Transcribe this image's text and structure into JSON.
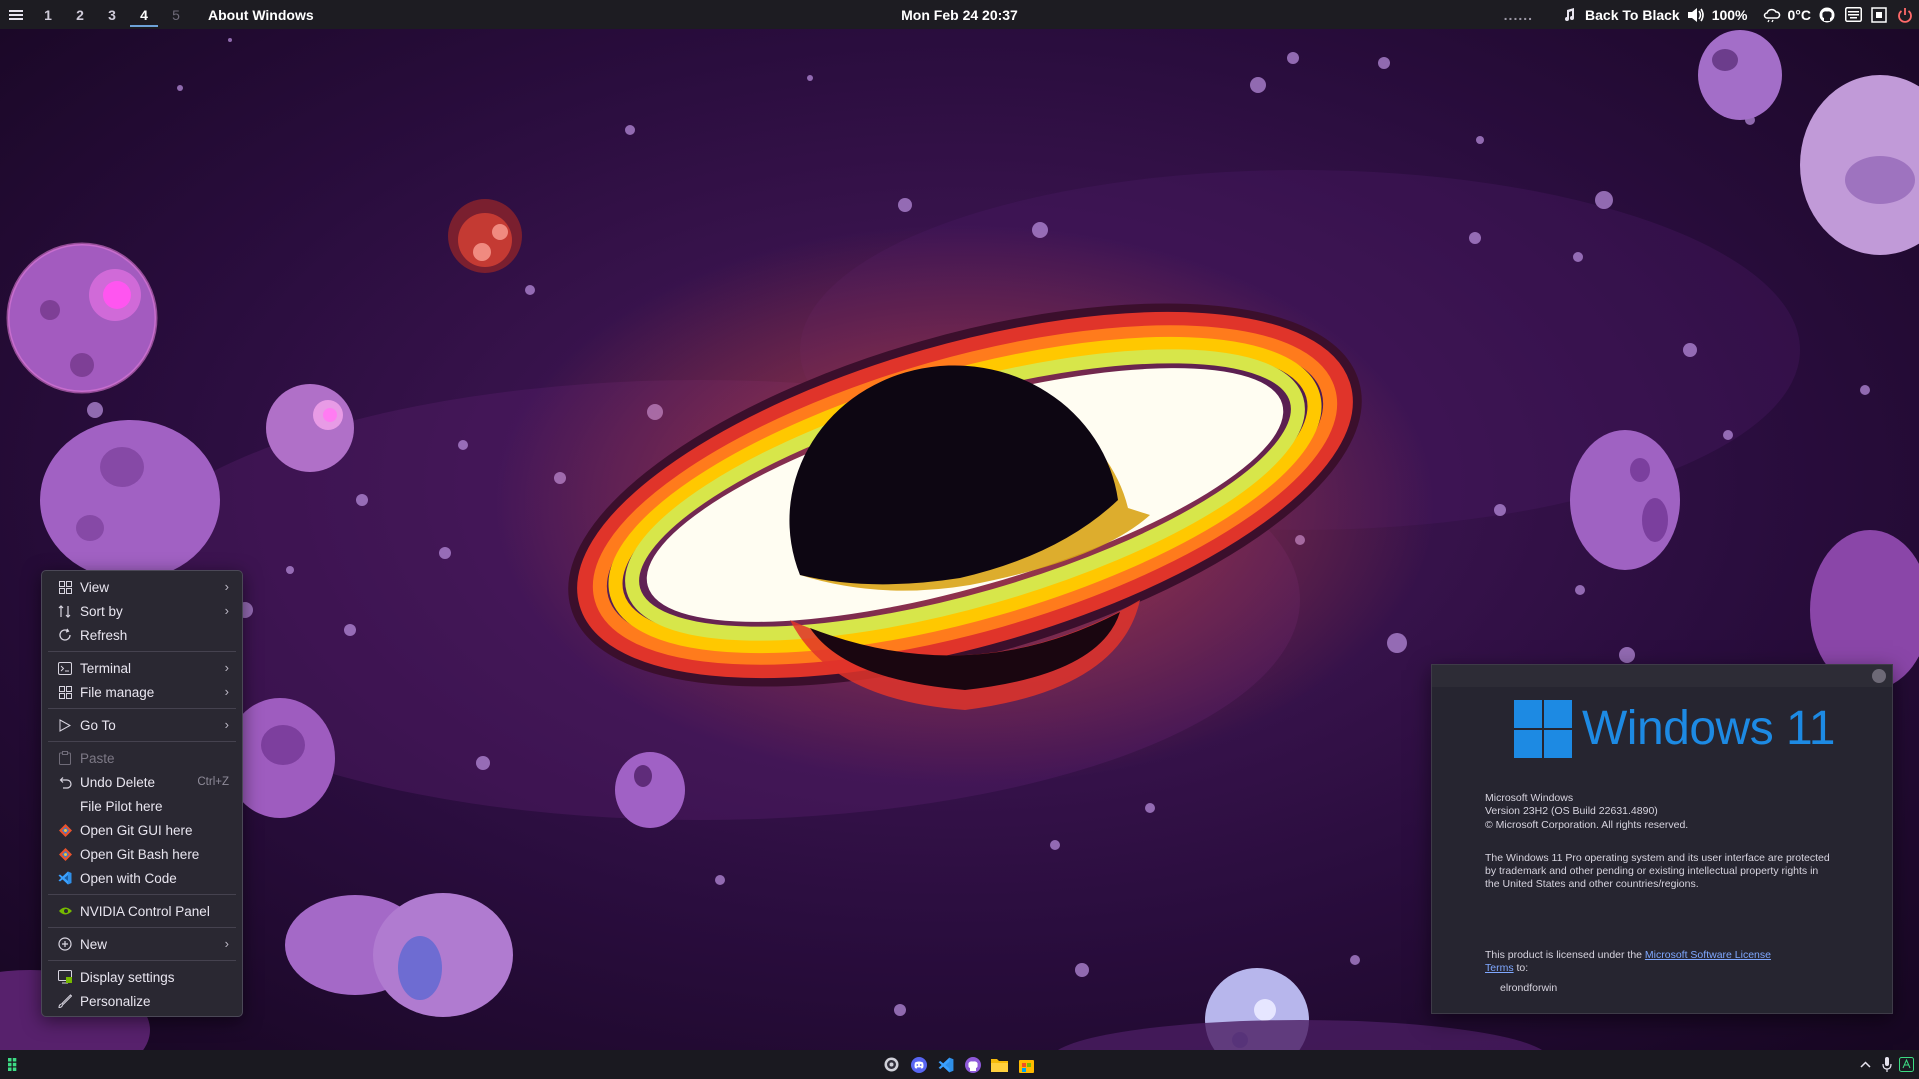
{
  "topbar": {
    "workspaces": [
      "1",
      "2",
      "3",
      "4",
      "5"
    ],
    "active_workspace": "4",
    "window_title": "About Windows",
    "clock": "Mon Feb 24 20:37",
    "dots": "......",
    "media": "Back To Black",
    "volume": "100%",
    "weather": "0°C"
  },
  "context_menu": {
    "view": "View",
    "sort_by": "Sort by",
    "refresh": "Refresh",
    "terminal": "Terminal",
    "file_manage": "File manage",
    "go_to": "Go To",
    "paste": "Paste",
    "undo_delete": "Undo Delete",
    "undo_shortcut": "Ctrl+Z",
    "file_pilot": "File Pilot here",
    "git_gui": "Open Git GUI here",
    "git_bash": "Open Git Bash here",
    "open_code": "Open with Code",
    "nvidia": "NVIDIA Control Panel",
    "new": "New",
    "display_settings": "Display settings",
    "personalize": "Personalize"
  },
  "about": {
    "brand": "Windows 11",
    "product": "Microsoft Windows",
    "version": "Version 23H2 (OS Build 22631.4890)",
    "copyright": "© Microsoft Corporation. All rights reserved.",
    "legal_1": "The Windows 11 Pro operating system and its user interface are protected",
    "legal_2": "by trademark and other pending or existing intellectual property rights in",
    "legal_3": "the United States and other countries/regions.",
    "license_prefix": "This product is licensed under the ",
    "license_link_1": "Microsoft Software License",
    "license_link_2": "Terms",
    "license_suffix": " to:",
    "user": "elrondforwin"
  },
  "colors": {
    "accent_blue": "#1d8ae3",
    "bar_bg": "#1d1c22",
    "menu_bg": "#2a2832"
  },
  "icons": {
    "taskbar": [
      "start-icon",
      "obs-icon",
      "discord-icon",
      "vscode-icon",
      "github-desktop-icon",
      "file-explorer-icon",
      "ms-store-icon"
    ],
    "tray": [
      "music-note-icon",
      "volume-icon",
      "weather-icon",
      "github-icon",
      "keyboard-icon",
      "screenshot-icon",
      "power-icon",
      "chevron-up-icon",
      "mic-icon",
      "language-icon"
    ]
  }
}
